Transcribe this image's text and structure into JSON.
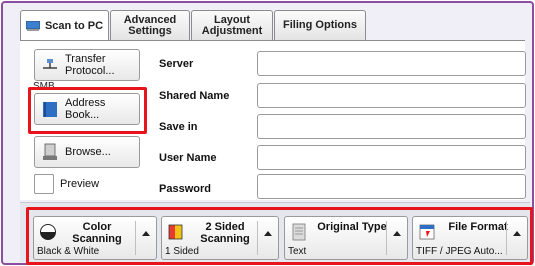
{
  "tabs": [
    {
      "label": "Scan to PC",
      "icon": "scan-to-pc-icon"
    },
    {
      "label": "Advanced Settings",
      "icon": ""
    },
    {
      "label": "Layout Adjustment",
      "icon": ""
    },
    {
      "label": "Filing Options",
      "icon": ""
    }
  ],
  "left_buttons": {
    "transfer_protocol": "Transfer Protocol...",
    "protocol_value": "SMB",
    "address_book": "Address Book...",
    "browse": "Browse..."
  },
  "fields": [
    {
      "label": "Server",
      "value": ""
    },
    {
      "label": "Shared Name",
      "value": ""
    },
    {
      "label": "Save in",
      "value": ""
    },
    {
      "label": "User Name",
      "value": ""
    },
    {
      "label": "Password",
      "value": ""
    }
  ],
  "preview_label": "Preview",
  "bottom_buttons": {
    "color": {
      "title": "Color Scanning",
      "value": "Black & White"
    },
    "sided": {
      "title": "2 Sided Scanning",
      "value": "1 Sided"
    },
    "original": {
      "title": "Original Type",
      "value": "Text"
    },
    "format": {
      "title": "File Format",
      "value": "TIFF / JPEG Auto..."
    }
  },
  "colors": {
    "frame": "#8a4f9e",
    "highlight": "#e8141b",
    "accent_blue": "#2e6fc4"
  }
}
